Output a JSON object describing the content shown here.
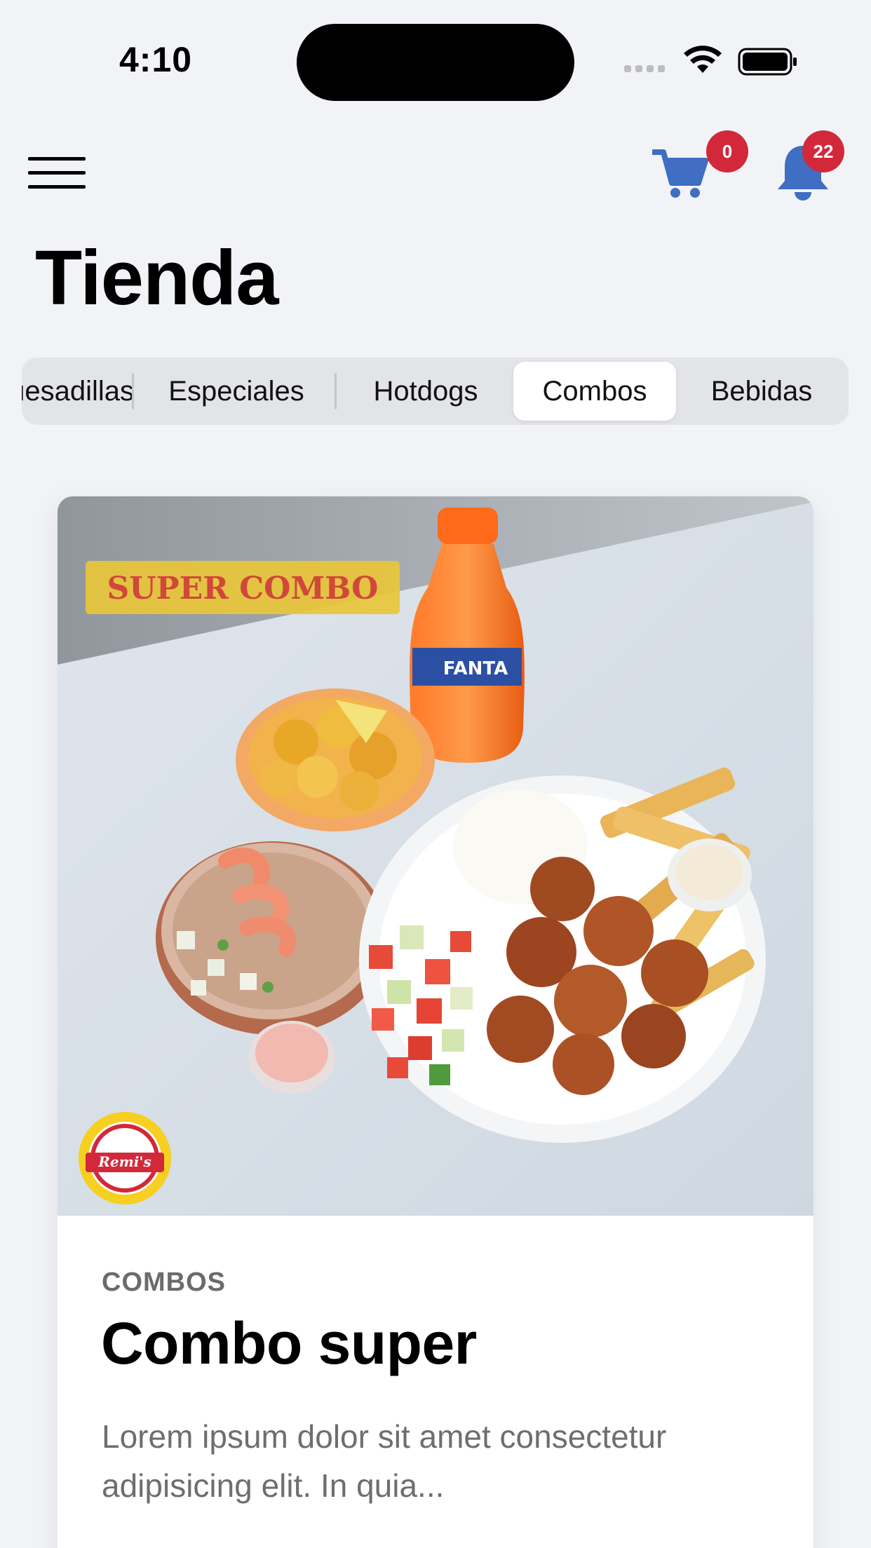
{
  "status_bar": {
    "time": "4:10"
  },
  "header": {
    "cart_badge": "0",
    "notification_badge": "22",
    "title": "Tienda"
  },
  "tabs": [
    {
      "label": "Quesadillas"
    },
    {
      "label": "Especiales"
    },
    {
      "label": "Hotdogs"
    },
    {
      "label": "Combos",
      "active": true
    },
    {
      "label": "Bebidas"
    }
  ],
  "product": {
    "image_banner": "SUPER COMBO",
    "bottle_label": "FANTA",
    "logo_text": "Remi's",
    "category": "COMBOS",
    "name": "Combo super",
    "description": "Lorem ipsum dolor sit amet consectetur adipisicing elit. In quia..."
  },
  "colors": {
    "accent_blue": "#3f6ec2",
    "badge_red": "#d3283a",
    "background": "#f2f3f7"
  }
}
